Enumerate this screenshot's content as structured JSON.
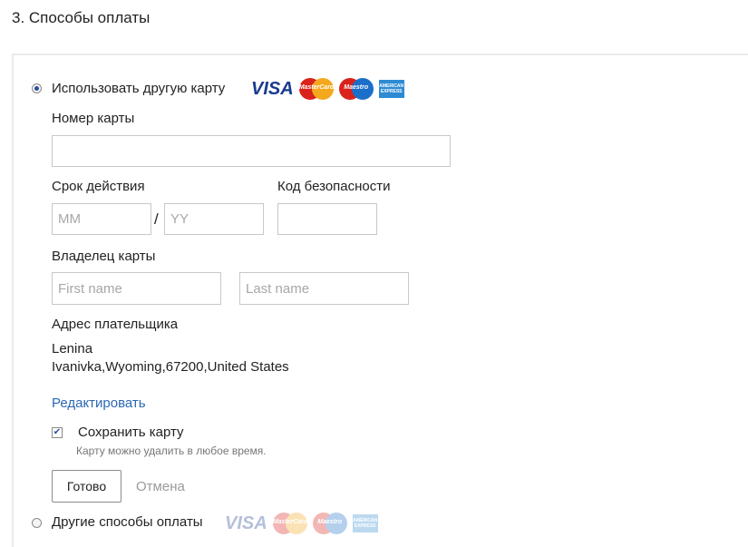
{
  "section": {
    "title": "3. Способы оплаты"
  },
  "option_card": {
    "label": "Использовать другую карту",
    "selected": true,
    "card_logos": [
      "visa",
      "mastercard",
      "maestro",
      "amex"
    ]
  },
  "card_number": {
    "label": "Номер карты",
    "value": "",
    "placeholder": ""
  },
  "expiry": {
    "label": "Срок действия",
    "month_placeholder": "MM",
    "separator": "/",
    "year_placeholder": "YY"
  },
  "security": {
    "label": "Код безопасности",
    "value": ""
  },
  "owner": {
    "label": "Владелец карты",
    "first_placeholder": "First name",
    "last_placeholder": "Last name"
  },
  "billing": {
    "label": "Адрес плательщика",
    "line1": "Lenina",
    "line2": "Ivanivka,Wyoming,67200,United States",
    "edit_link": "Редактировать"
  },
  "save_card": {
    "label": "Сохранить карту",
    "checked": true,
    "hint": "Карту можно удалить в любое время."
  },
  "actions": {
    "done": "Готово",
    "cancel": "Отмена"
  },
  "option_other": {
    "label": "Другие способы оплаты",
    "selected": false,
    "card_logos": [
      "visa",
      "mastercard",
      "maestro",
      "amex"
    ]
  },
  "logos": {
    "visa": "VISA",
    "mastercard": "MasterCard",
    "maestro": "Maestro",
    "amex": "AMERICAN EXPRESS"
  },
  "colors": {
    "link": "#2a68b3",
    "visa": "#1a3a8f",
    "radio_dot": "#2b4f9c"
  }
}
